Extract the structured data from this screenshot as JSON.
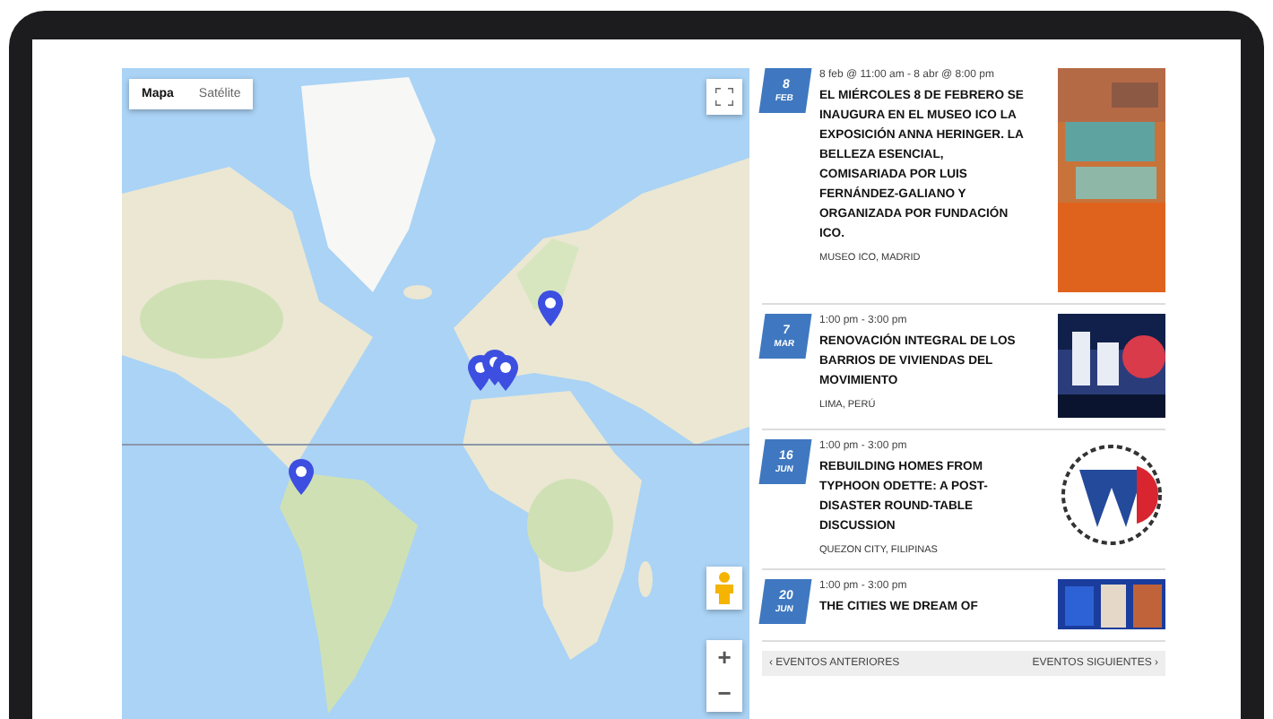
{
  "map": {
    "kind": "picture",
    "map_types": [
      {
        "label": "Mapa",
        "selected": true
      },
      {
        "label": "Satélite",
        "selected": false
      }
    ],
    "zoom_controls": [
      "+",
      "−"
    ]
  },
  "events": [
    {
      "day": "8",
      "month": "FEB",
      "time": "8 feb @ 11:00 am - 8 abr @ 8:00 pm",
      "title": "EL MIÉRCOLES 8 DE FEBRERO SE INAUGURA EN EL MUSEO ICO LA EXPOSICIÓN ANNA HERINGER. LA BELLEZA ESENCIAL, COMISARIADA POR LUIS FERNÁNDEZ-GALIANO Y ORGANIZADA POR FUNDACIÓN ICO.",
      "venue": "MUSEO ICO, MADRID"
    },
    {
      "day": "7",
      "month": "MAR",
      "time": "1:00 pm - 3:00 pm",
      "title": "RENOVACIÓN INTEGRAL DE LOS BARRIOS DE VIVIENDAS DEL MOVIMIENTO",
      "venue": "LIMA, PERÚ"
    },
    {
      "day": "16",
      "month": "JUN",
      "time": "1:00 pm - 3:00 pm",
      "title": "REBUILDING HOMES FROM TYPHOON ODETTE: A POST-DISASTER ROUND-TABLE DISCUSSION",
      "venue": "QUEZON CITY, FILIPINAS"
    },
    {
      "day": "20",
      "month": "JUN",
      "time": "1:00 pm - 3:00 pm",
      "title": "THE CITIES WE DREAM OF"
    }
  ],
  "pager": {
    "previous": "‹ EVENTOS ANTERIORES",
    "next": "EVENTOS SIGUIENTES ›"
  }
}
